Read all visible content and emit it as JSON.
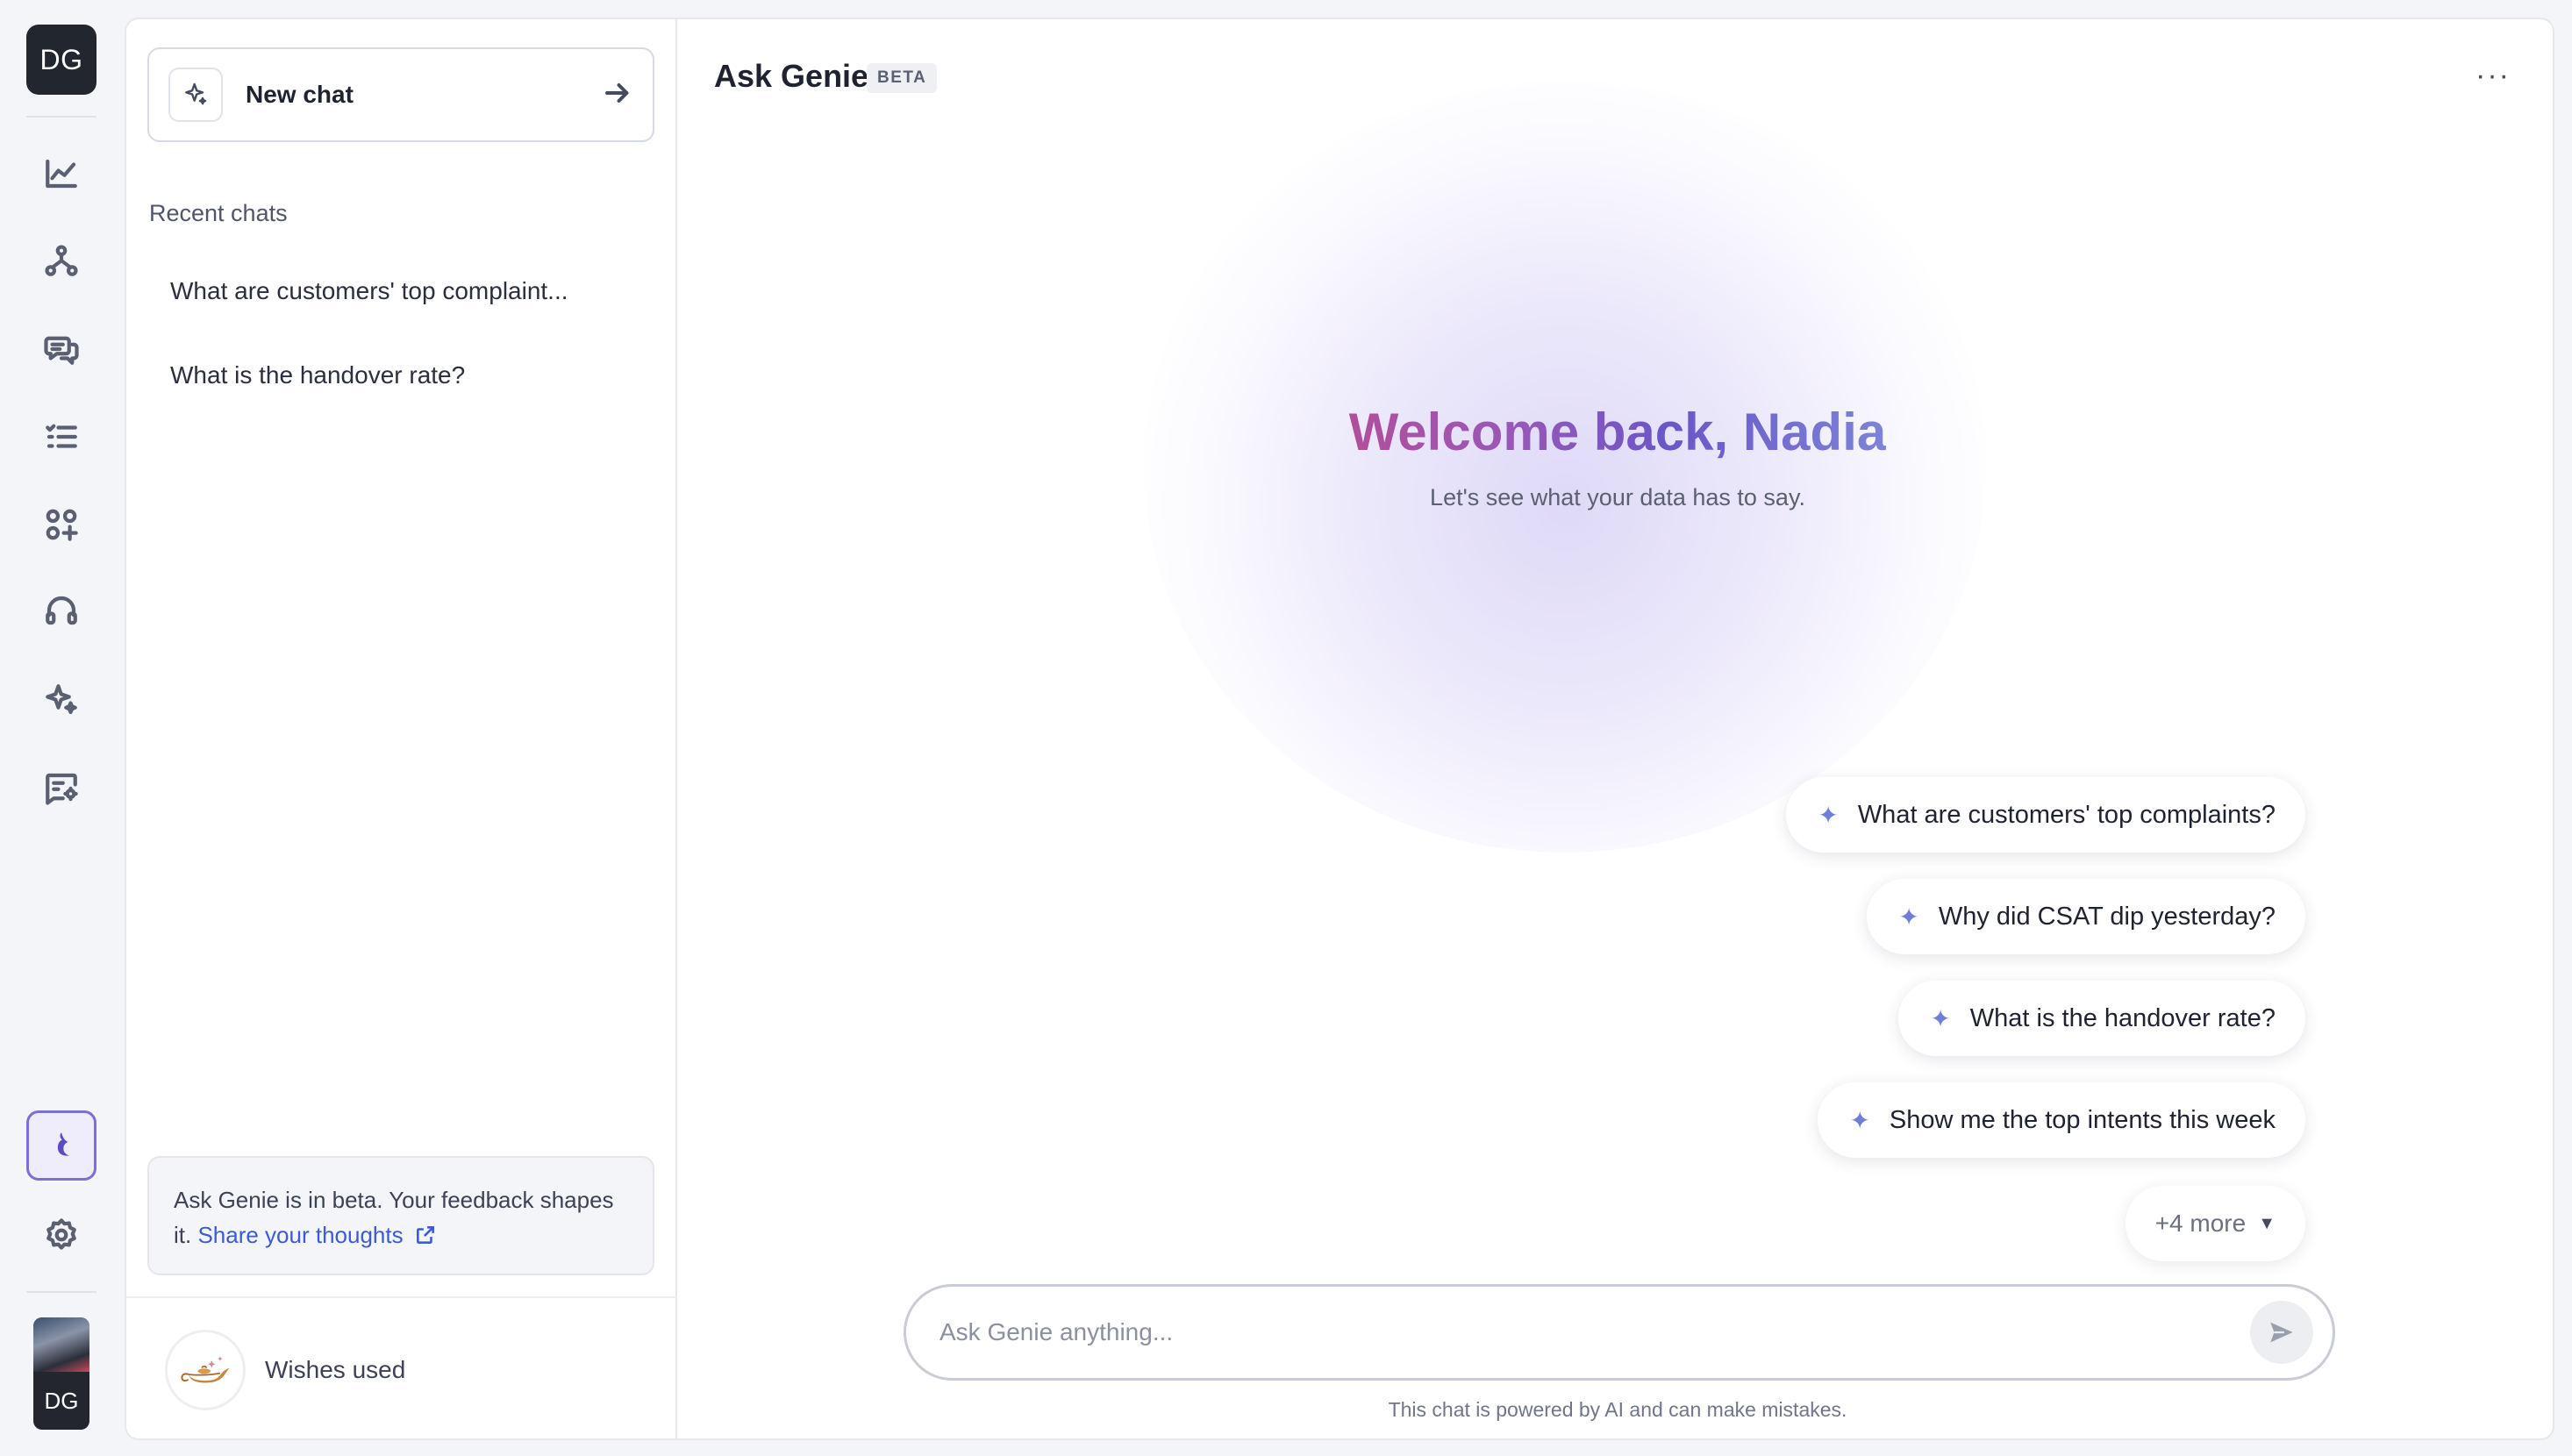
{
  "rail": {
    "logo_initials": "DG",
    "icons": [
      "analytics-icon",
      "workflow-icon",
      "conversations-icon",
      "tasks-list-icon",
      "apps-add-icon",
      "headset-icon",
      "sparkle-ai-icon",
      "chat-settings-icon"
    ],
    "active": "genie-icon",
    "settings": "gear-icon",
    "avatar_initials": "DG"
  },
  "sidebar": {
    "new_chat_label": "New chat",
    "recent_title": "Recent chats",
    "recent_items": [
      "What are customers' top complaint...",
      "What is the handover rate?"
    ],
    "beta_notice": "Ask Genie is in beta. Your feedback shapes it.",
    "beta_link": "Share your thoughts",
    "wishes_label": "Wishes used"
  },
  "header": {
    "title": "Ask Genie",
    "badge": "BETA",
    "menu": "···"
  },
  "hero": {
    "welcome": "Welcome back, Nadia",
    "subtitle": "Let's see what your data has to say."
  },
  "suggestions": [
    "What are customers' top complaints?",
    "Why did CSAT dip yesterday?",
    "What is the handover rate?",
    "Show me the top intents this week"
  ],
  "more_suggestions": "+4 more",
  "composer": {
    "placeholder": "Ask Genie anything...",
    "disclaimer": "This chat is powered by AI and can make mistakes."
  },
  "colors": {
    "accent": "#6f7ed6",
    "link": "#3b5bd6",
    "genie_active_border": "#7c6fd6"
  }
}
